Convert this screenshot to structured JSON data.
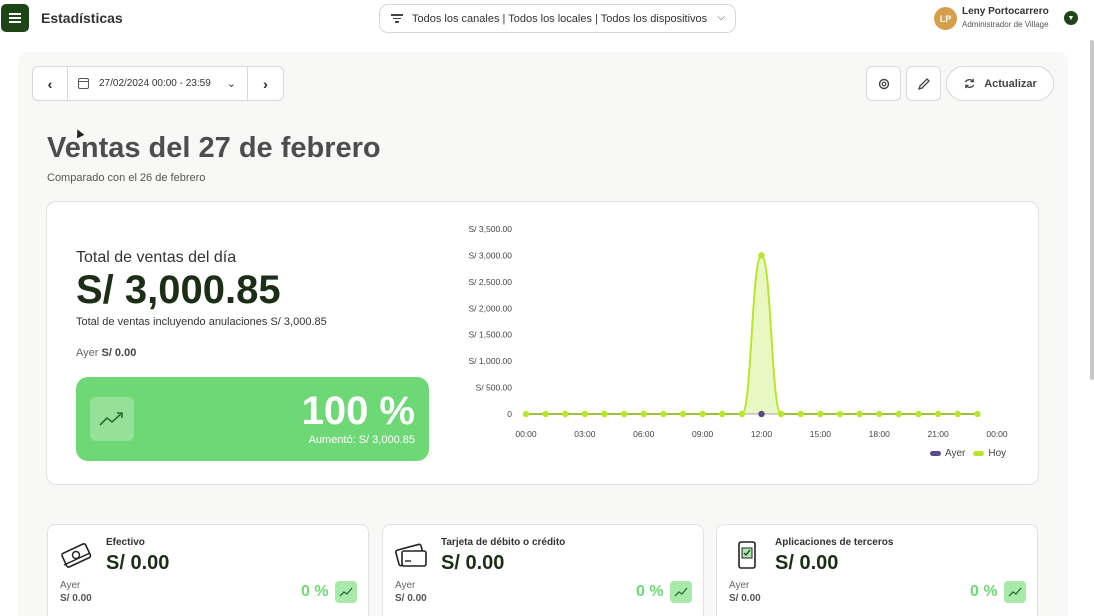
{
  "header": {
    "title": "Estadísticas",
    "filter_label": "Todos los canales | Todos los locales | Todos los dispositivos",
    "user": {
      "initials": "LP",
      "name": "Leny Portocarrero",
      "role": "Administrador de Village"
    }
  },
  "toolbar": {
    "date_range": "27/02/2024 00:00 - 23:59",
    "refresh_label": "Actualizar"
  },
  "page": {
    "title": "Ventas del 27 de febrero",
    "subtitle": "Comparado con el 26 de febrero"
  },
  "summary": {
    "label": "Total de ventas del día",
    "value": "S/ 3,000.85",
    "note": "Total de ventas incluyendo anulaciones S/ 3,000.85",
    "yesterday_label": "Ayer",
    "yesterday_value": "S/ 0.00",
    "growth_pct": "100 %",
    "growth_note": "Aumentó: S/ 3,000.85"
  },
  "colors": {
    "accent_dark": "#1e4516",
    "growth_green": "#6fd876",
    "today_series": "#b8e62a",
    "yesterday_series": "#5b4a8a"
  },
  "chart_data": {
    "type": "area",
    "x_ticks": [
      "00:00",
      "03:00",
      "06:00",
      "09:00",
      "12:00",
      "15:00",
      "18:00",
      "21:00",
      "00:00"
    ],
    "y_ticks": [
      "0",
      "S/ 500.00",
      "S/ 1,000.00",
      "S/ 1,500.00",
      "S/ 2,000.00",
      "S/ 2,500.00",
      "S/ 3,000.00",
      "S/ 3,500.00"
    ],
    "ylim": [
      0,
      3500
    ],
    "xlim": [
      0,
      24
    ],
    "hours": [
      0,
      1,
      2,
      3,
      4,
      5,
      6,
      7,
      8,
      9,
      10,
      11,
      12,
      13,
      14,
      15,
      16,
      17,
      18,
      19,
      20,
      21,
      22,
      23
    ],
    "series": [
      {
        "name": "Ayer",
        "values": [
          0,
          0,
          0,
          0,
          0,
          0,
          0,
          0,
          0,
          0,
          0,
          0,
          0,
          0,
          0,
          0,
          0,
          0,
          0,
          0,
          0,
          0,
          0,
          0
        ]
      },
      {
        "name": "Hoy",
        "values": [
          0,
          0,
          0,
          0,
          0,
          0,
          0,
          0,
          0,
          0,
          0,
          0,
          3000.85,
          0,
          0,
          0,
          0,
          0,
          0,
          0,
          0,
          0,
          0,
          0
        ]
      }
    ],
    "legend": "bottom-right"
  },
  "payment_methods": [
    {
      "name": "Efectivo",
      "value": "S/ 0.00",
      "yesterday_label": "Ayer",
      "yesterday_value": "S/ 0.00",
      "pct": "0 %",
      "icon": "cash-icon"
    },
    {
      "name": "Tarjeta de débito o crédito",
      "value": "S/ 0.00",
      "yesterday_label": "Ayer",
      "yesterday_value": "S/ 0.00",
      "pct": "0 %",
      "icon": "card-icon"
    },
    {
      "name": "Aplicaciones de terceros",
      "value": "S/ 0.00",
      "yesterday_label": "Ayer",
      "yesterday_value": "S/ 0.00",
      "pct": "0 %",
      "icon": "phone-app-icon"
    }
  ]
}
